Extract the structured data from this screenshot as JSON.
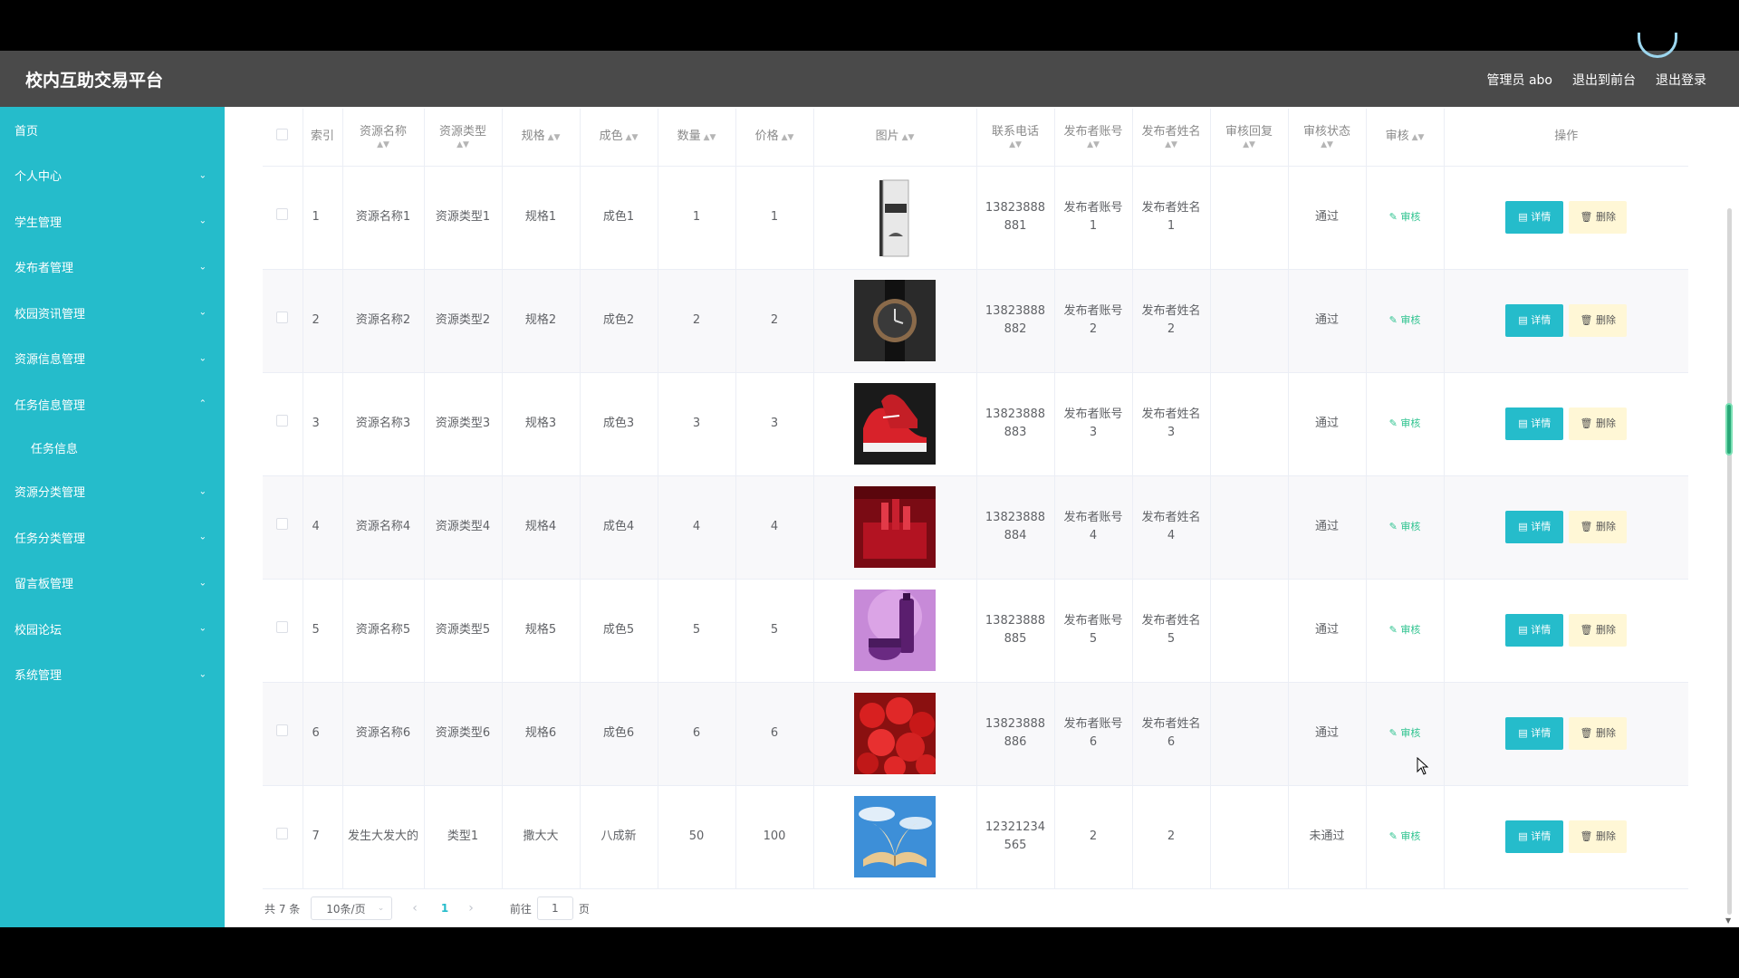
{
  "header": {
    "title": "校内互助交易平台",
    "admin_label": "管理员 abo",
    "exit_front": "退出到前台",
    "logout": "退出登录"
  },
  "sidebar": {
    "items": [
      {
        "label": "首页",
        "icon": "none"
      },
      {
        "label": "个人中心",
        "icon": "chevron-down"
      },
      {
        "label": "学生管理",
        "icon": "chevron-down"
      },
      {
        "label": "发布者管理",
        "icon": "chevron-down"
      },
      {
        "label": "校园资讯管理",
        "icon": "chevron-down"
      },
      {
        "label": "资源信息管理",
        "icon": "chevron-down"
      },
      {
        "label": "任务信息管理",
        "icon": "chevron-up"
      },
      {
        "label": "任务信息",
        "icon": "none"
      },
      {
        "label": "资源分类管理",
        "icon": "chevron-down"
      },
      {
        "label": "任务分类管理",
        "icon": "chevron-down"
      },
      {
        "label": "留言板管理",
        "icon": "chevron-down"
      },
      {
        "label": "校园论坛",
        "icon": "chevron-down"
      },
      {
        "label": "系统管理",
        "icon": "chevron-down"
      }
    ]
  },
  "table": {
    "headers": {
      "index": "索引",
      "name": "资源名称",
      "type": "资源类型",
      "spec": "规格",
      "condition": "成色",
      "qty": "数量",
      "price": "价格",
      "image": "图片",
      "phone": "联系电话",
      "publisher_account": "发布者账号",
      "publisher_name": "发布者姓名",
      "audit_reply": "审核回复",
      "audit_status": "审核状态",
      "audit": "审核",
      "ops": "操作"
    },
    "audit_action": "审核",
    "detail_label": "详情",
    "delete_label": "删除",
    "rows": [
      {
        "index": "1",
        "name": "资源名称1",
        "type": "资源类型1",
        "spec": "规格1",
        "condition": "成色1",
        "qty": "1",
        "price": "1",
        "image": "book-cover",
        "phone": "13823888881",
        "account": "发布者账号1",
        "pname": "发布者姓名1",
        "reply": "",
        "status": "通过"
      },
      {
        "index": "2",
        "name": "资源名称2",
        "type": "资源类型2",
        "spec": "规格2",
        "condition": "成色2",
        "qty": "2",
        "price": "2",
        "image": "wristwatch",
        "phone": "13823888882",
        "account": "发布者账号2",
        "pname": "发布者姓名2",
        "reply": "",
        "status": "通过"
      },
      {
        "index": "3",
        "name": "资源名称3",
        "type": "资源类型3",
        "spec": "规格3",
        "condition": "成色3",
        "qty": "3",
        "price": "3",
        "image": "red-sneakers",
        "phone": "13823888883",
        "account": "发布者账号3",
        "pname": "发布者姓名3",
        "reply": "",
        "status": "通过"
      },
      {
        "index": "4",
        "name": "资源名称4",
        "type": "资源类型4",
        "spec": "规格4",
        "condition": "成色4",
        "qty": "4",
        "price": "4",
        "image": "red-lipsticks",
        "phone": "13823888884",
        "account": "发布者账号4",
        "pname": "发布者姓名4",
        "reply": "",
        "status": "通过"
      },
      {
        "index": "5",
        "name": "资源名称5",
        "type": "资源类型5",
        "spec": "规格5",
        "condition": "成色5",
        "qty": "5",
        "price": "5",
        "image": "purple-cosmetics",
        "phone": "13823888885",
        "account": "发布者账号5",
        "pname": "发布者姓名5",
        "reply": "",
        "status": "通过"
      },
      {
        "index": "6",
        "name": "资源名称6",
        "type": "资源类型6",
        "spec": "规格6",
        "condition": "成色6",
        "qty": "6",
        "price": "6",
        "image": "cherries",
        "phone": "13823888886",
        "account": "发布者账号6",
        "pname": "发布者姓名6",
        "reply": "",
        "status": "通过"
      },
      {
        "index": "7",
        "name": "发生大发大的",
        "type": "类型1",
        "spec": "撒大大",
        "condition": "八成新",
        "qty": "50",
        "price": "100",
        "image": "open-book-sky",
        "phone": "12321234565",
        "account": "2",
        "pname": "2",
        "reply": "",
        "status": "未通过"
      }
    ]
  },
  "pagination": {
    "total": "共 7 条",
    "page_size": "10条/页",
    "current_page": "1",
    "goto_label": "前往",
    "goto_value": "1",
    "page_unit": "页"
  },
  "colors": {
    "sidebar": "#25bccb",
    "header": "#4a4a4a",
    "accent": "#25bccb",
    "audit_link": "#2ec38f",
    "delete_bg": "#fff7d6"
  }
}
